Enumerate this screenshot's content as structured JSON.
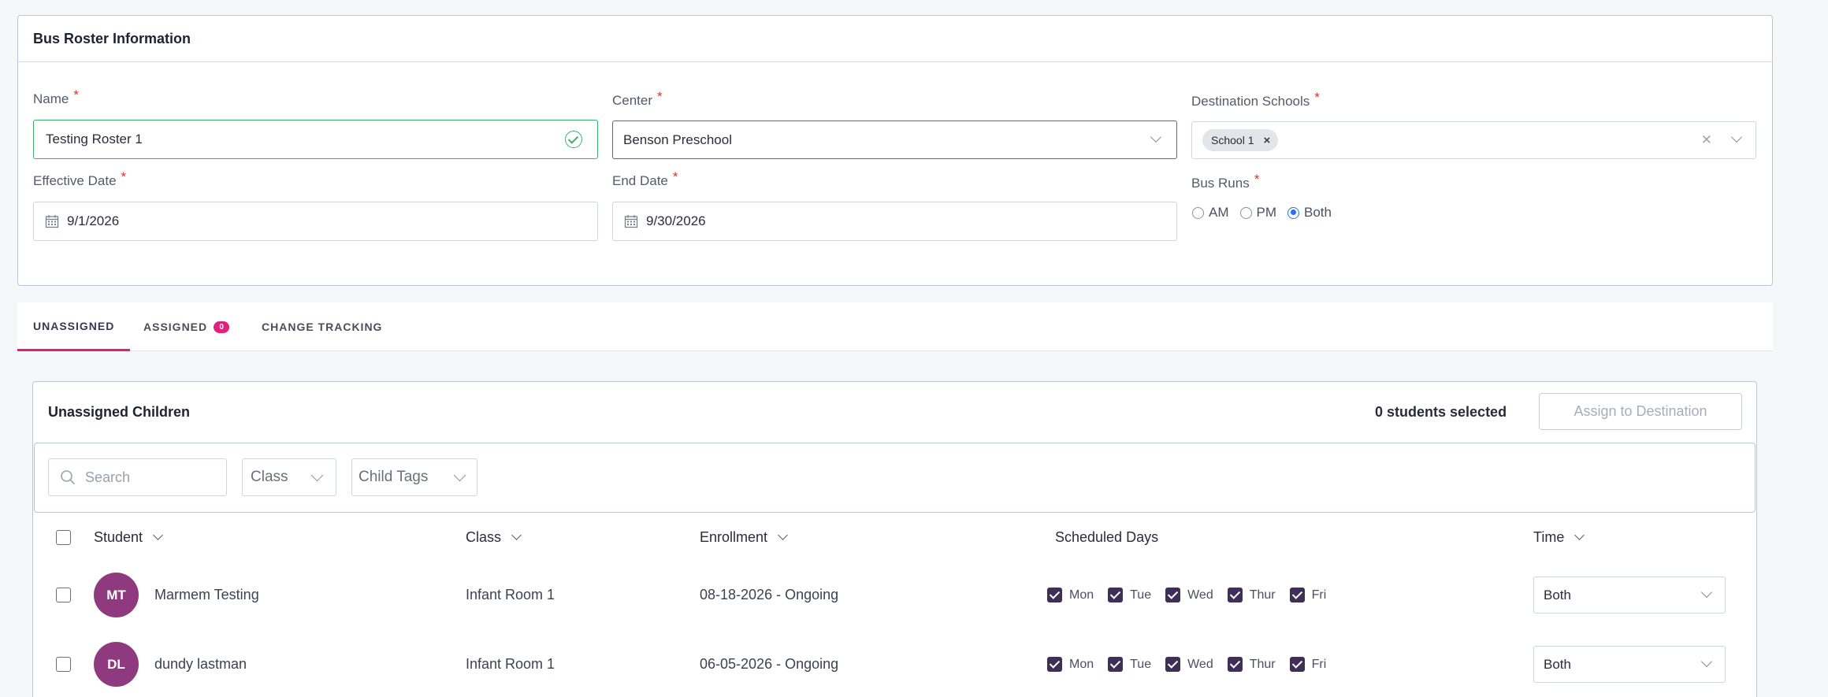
{
  "roster_card": {
    "title": "Bus Roster Information",
    "name_label": "Name",
    "name_value": "Testing Roster 1",
    "center_label": "Center",
    "center_value": "Benson Preschool",
    "destination_label": "Destination Schools",
    "destination_chips": [
      "School 1"
    ],
    "chip_remove_glyph": "×",
    "clear_glyph": "✕",
    "effective_label": "Effective Date",
    "effective_value": "9/1/2026",
    "end_label": "End Date",
    "end_value": "9/30/2026",
    "bus_runs_label": "Bus Runs",
    "bus_runs_options": [
      "AM",
      "PM",
      "Both"
    ],
    "bus_runs_selected": "Both",
    "required_mark": "*"
  },
  "tabs": [
    {
      "label": "UNASSIGNED",
      "active": true
    },
    {
      "label": "ASSIGNED",
      "badge": "0",
      "active": false
    },
    {
      "label": "CHANGE TRACKING",
      "active": false
    }
  ],
  "unassigned": {
    "title": "Unassigned Children",
    "selected_text": "0 students selected",
    "assign_button": "Assign to Destination",
    "search_placeholder": "Search",
    "class_filter": "Class",
    "tags_filter": "Child Tags",
    "columns": {
      "student": "Student",
      "class": "Class",
      "enrollment": "Enrollment",
      "scheduled_days": "Scheduled Days",
      "time": "Time"
    },
    "rows": [
      {
        "initials": "MT",
        "name": "Marmem Testing",
        "class": "Infant Room 1",
        "enrollment": "08-18-2026 - Ongoing",
        "days": [
          "Mon",
          "Tue",
          "Wed",
          "Thur",
          "Fri"
        ],
        "time": "Both"
      },
      {
        "initials": "DL",
        "name": "dundy lastman",
        "class": "Infant Room 1",
        "enrollment": "06-05-2026 - Ongoing",
        "days": [
          "Mon",
          "Tue",
          "Wed",
          "Thur",
          "Fri"
        ],
        "time": "Both"
      }
    ]
  },
  "colors": {
    "accent_pink": "#e0207a",
    "avatar_purple": "#8f3a7f",
    "valid_green": "#3bb26a",
    "checkbox_dark": "#3f2f56",
    "radio_blue": "#2f6fe4"
  }
}
